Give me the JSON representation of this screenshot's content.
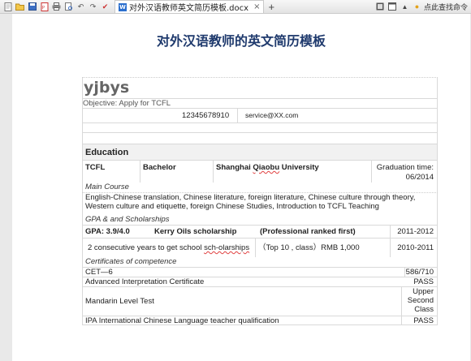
{
  "tab": {
    "title": "对外汉语教师英文简历模板.docx",
    "close": "×",
    "new_tab": "+"
  },
  "toolbar": {
    "help_label": "点此查找命令"
  },
  "doc": {
    "heading": "对外汉语教师的英文简历模板",
    "name": "yjbys",
    "objective_prefix": "Objective: Apply for ",
    "objective_target": "TCFL",
    "phone": "12345678910",
    "email": "service@XX.com",
    "section_education": "Education",
    "edu": {
      "program": "TCFL",
      "degree": "Bachelor",
      "school_prefix": "Shanghai ",
      "school_mid": "Qiaobu",
      "school_suffix": " University",
      "grad_label": "Graduation time:",
      "grad_date": "06/2014"
    },
    "main_course_label": "Main Course",
    "main_course_text": "English-Chinese translation, Chinese literature, foreign literature, Chinese culture through theory, Western culture and etiquette, foreign Chinese Studies, Introduction to TCFL Teaching",
    "gpa_label": "GPA & and Scholarships",
    "gpa": {
      "gpa_text": "GPA:  3.9/4.0",
      "scholarship": "Kerry Oils scholarship",
      "rank": "(Professional ranked first)",
      "years": "2011-2012"
    },
    "scholarship2": {
      "prefix": "2 consecutive years to get school ",
      "word": "sch-olarships",
      "detail": "（Top 10 , class）RMB 1,000",
      "years": "2010-2011"
    },
    "cert_label": "Certificates of competence",
    "certs": [
      {
        "name": "CET—6",
        "result": "586/710"
      },
      {
        "name": "Advanced Interpretation Certificate",
        "result": "PASS"
      },
      {
        "name": "Mandarin Level Test",
        "result_line1": "Upper",
        "result_line2": "Second",
        "result_line3": "Class"
      },
      {
        "name": "IPA International Chinese Language teacher qualification",
        "result": "PASS"
      }
    ]
  }
}
